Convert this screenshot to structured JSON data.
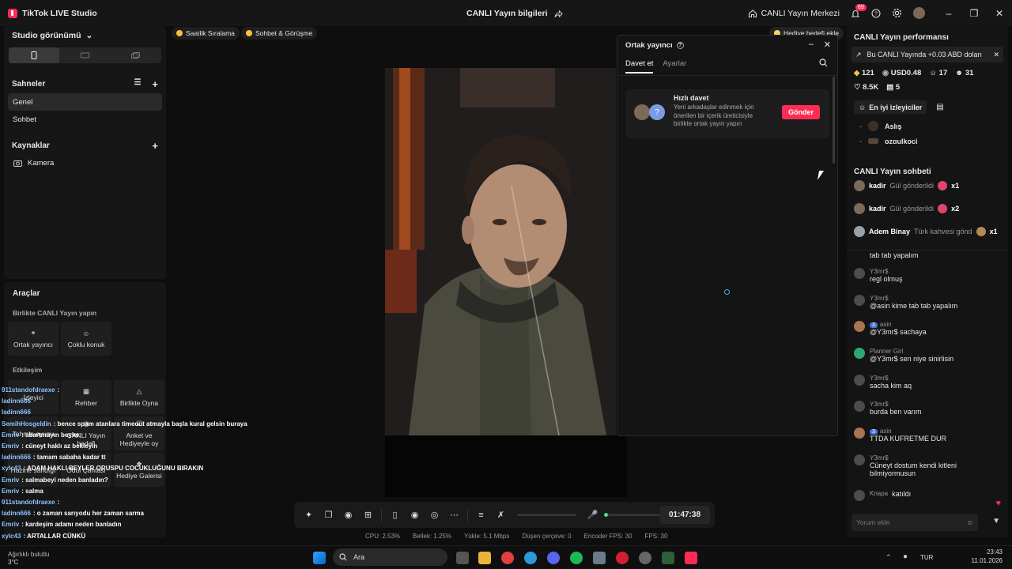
{
  "app": {
    "title": "TikTok LIVE Studio",
    "live_info": "CANLI Yayın bilgileri",
    "live_center": "CANLI Yayın Merkezi",
    "notif_count": "69"
  },
  "studio": {
    "view_label": "Studio görünümü",
    "scenes_label": "Sahneler",
    "scenes": [
      "Genel",
      "Sohbet"
    ],
    "sources_label": "Kaynaklar",
    "sources": [
      "Kamera"
    ]
  },
  "tools": {
    "title": "Araçlar",
    "together_label": "Birlikte CANLI Yayın yapın",
    "together": [
      "Ortak yayıncı",
      "Çoklu konuk"
    ],
    "interaction_label": "Etkileşim",
    "interaction": [
      "İzleyici",
      "Rehber",
      "Birlikte Oyna",
      "Tahmin oyunu",
      "CANLI Yayın hedefi",
      "Anket ve Hediyeyle oy",
      "Hazine sandığı",
      "Ödül Çantası",
      "Hediye Galerisi"
    ]
  },
  "chips": {
    "hourly": "Saatlik Sıralama",
    "chat_meet": "Sohbet & Görüşme",
    "gift_goal": "Hediye hedefi ekle"
  },
  "cohost": {
    "title": "Ortak yayıncı",
    "tabs": [
      "Davet et",
      "Ayarlar"
    ],
    "quick_title": "Hızlı davet",
    "quick_desc": "Yeni arkadaşlar edinmek için önerilen bir içerik üreticisiyle birlikte ortak yayın yapın",
    "send": "Gönder"
  },
  "performance": {
    "title": "CANLI Yayın performansı",
    "earn_note": "Bu CANLI Yayında +0.03 ABD doları",
    "diamonds": "121",
    "usd": "USD0.48",
    "viewers": "17",
    "new_followers": "31",
    "likes": "8.5K",
    "gifts": "5",
    "top_viewers": "En iyi izleyiciler",
    "top_list": [
      "Aslış",
      "ozgulkoci"
    ]
  },
  "chat": {
    "title": "CANLI Yayın sohbeti",
    "gifts": [
      {
        "user": "kadir",
        "action": "Gül gönderildi",
        "count": "x1"
      },
      {
        "user": "kadir",
        "action": "Gül gönderildi",
        "count": "x2"
      },
      {
        "user": "Adem Binay",
        "action": "Türk kahvesi gönd",
        "count": "x1"
      }
    ],
    "messages": [
      {
        "user": "",
        "text": "tab tab yapalım"
      },
      {
        "user": "Y3mr$",
        "text": "regl olmuş"
      },
      {
        "user": "Y3mr$",
        "text": "@asin kime tab tab yapalım"
      },
      {
        "user": "asin",
        "level": "3",
        "text": "@Y3mr$ sachaya"
      },
      {
        "user": "Planner Girl",
        "text": "@Y3mr$ sen niye sinirlisin"
      },
      {
        "user": "Y3mr$",
        "text": "sacha kim aq"
      },
      {
        "user": "Y3mr$",
        "text": "burda ben varım"
      },
      {
        "user": "asin",
        "level": "3",
        "text": "TTDA KUFRETME DUR"
      },
      {
        "user": "Y3mr$",
        "text": "Cüneyt dostum kendi kitleni bilmiyormusun"
      },
      {
        "user": "Knapa",
        "text": "katıldı"
      }
    ],
    "placeholder": "Yorum ekle"
  },
  "bottom": {
    "timer": "01:47:38"
  },
  "status": {
    "cpu": "CPU: 2.53%",
    "mem": "Bellek: 1.25%",
    "upload": "Yükle: 5.1 Mbps",
    "dropped": "Düşen çerçeve: 0",
    "encoder": "Encoder FPS: 30",
    "fps": "FPS: 30"
  },
  "overlay_chat": [
    {
      "u": "911standofdraexe",
      "t": ":"
    },
    {
      "u": "ladinn666",
      "t": ""
    },
    {
      "u": "ladinn666",
      "t": ""
    },
    {
      "u": "SemihHosgeldin",
      "t": ": bence spam atanlara timeout atmayla başla kural gelsin buraya"
    },
    {
      "u": "Emriv",
      "t": ": abartmayın beyler"
    },
    {
      "u": "Emriv",
      "t": ": cüneyt haklı az bekleyin"
    },
    {
      "u": "ladinn666",
      "t": ": tamam sabaha kadar tt"
    },
    {
      "u": "xylc43",
      "t": ": ADAM HAKLI BEYLER ORUSPU COCUKLUĞUNU BIRAKIN"
    },
    {
      "u": "Emriv",
      "t": ": salmabeyi neden banladın?"
    },
    {
      "u": "Emriv",
      "t": ": salma"
    },
    {
      "u": "911standofdraexe",
      "t": ":"
    },
    {
      "u": "ladinn666",
      "t": ": o zaman sarıyodu her zaman sarma"
    },
    {
      "u": "Emriv",
      "t": ": kardeşim adamı neden banladın"
    },
    {
      "u": "xylc43",
      "t": ": ARTALLAR CÜNKÜ"
    }
  ],
  "taskbar": {
    "search": "Ara",
    "weather": "3°C",
    "weather_desc": "Ağırlıklı bulutlu",
    "lang": "TUR",
    "time": "23:43",
    "date": "11.01.2026"
  },
  "colors": {
    "accent": "#fe2c55",
    "panel": "#161616",
    "bg": "#0e0e0e",
    "level_badge": "#4a73d9"
  }
}
